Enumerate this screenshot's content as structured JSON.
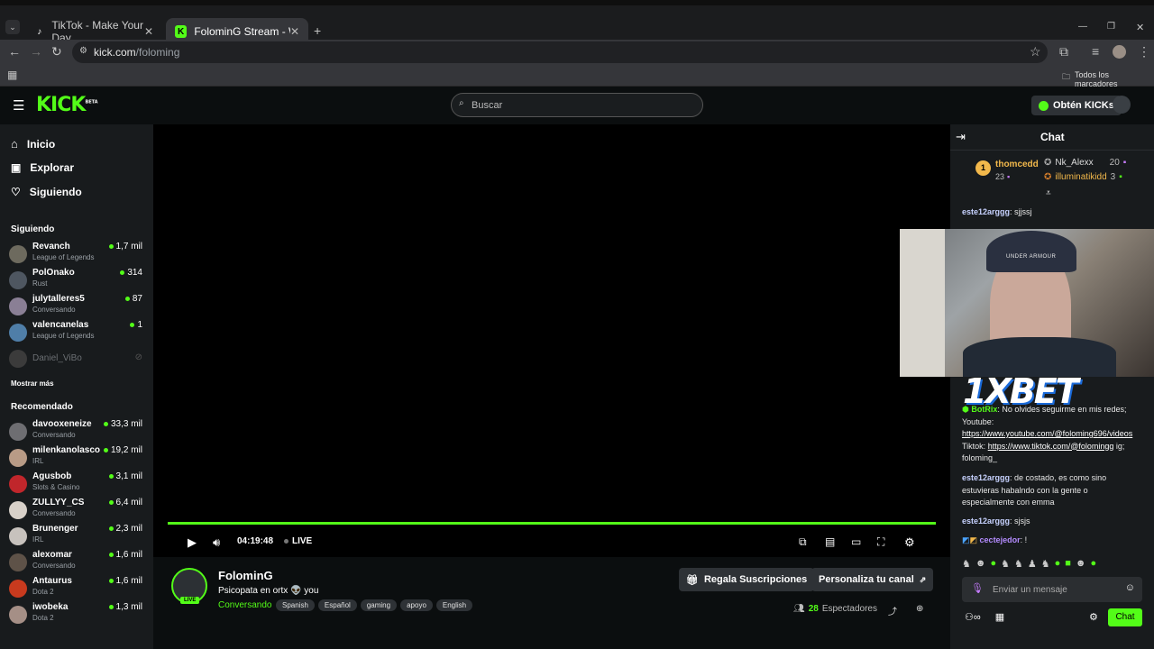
{
  "browser": {
    "tabs": [
      {
        "label": "TikTok - Make Your Day"
      },
      {
        "label": "FolominG Stream - Watch Live o"
      }
    ],
    "url_domain": "kick.com",
    "url_path": "/foloming",
    "bookmarks_label": "Todos los marcadores"
  },
  "header": {
    "logo": "KICK",
    "logo_badge": "BETA",
    "search_placeholder": "Buscar",
    "kicks_button": "Obtén KICKs",
    "accent": "#53fc18"
  },
  "sidebar": {
    "nav": [
      {
        "label": "Inicio",
        "icon": "home-icon"
      },
      {
        "label": "Explorar",
        "icon": "compass-icon"
      },
      {
        "label": "Siguiendo",
        "icon": "heart-icon"
      }
    ],
    "following_title": "Siguiendo",
    "following": [
      {
        "name": "Revanch",
        "category": "League of Legends",
        "viewers": "1,7 mil"
      },
      {
        "name": "PolOnako",
        "category": "Rust",
        "viewers": "314"
      },
      {
        "name": "julytalleres5",
        "category": "Conversando",
        "viewers": "87"
      },
      {
        "name": "valencanelas",
        "category": "League of Legends",
        "viewers": "1"
      }
    ],
    "offline": {
      "name": "Daniel_ViBo"
    },
    "show_more": "Mostrar más",
    "recommended_title": "Recomendado",
    "recommended": [
      {
        "name": "davooxeneize",
        "category": "Conversando",
        "viewers": "33,3 mil"
      },
      {
        "name": "milenkanolasco",
        "category": "IRL",
        "viewers": "19,2 mil"
      },
      {
        "name": "Agusbob",
        "category": "Slots & Casino",
        "viewers": "3,1 mil"
      },
      {
        "name": "ZULLYY_CS",
        "category": "Conversando",
        "viewers": "6,4 mil"
      },
      {
        "name": "Brunenger",
        "category": "IRL",
        "viewers": "2,3 mil"
      },
      {
        "name": "alexomar",
        "category": "Conversando",
        "viewers": "1,6 mil"
      },
      {
        "name": "Antaurus",
        "category": "Dota 2",
        "viewers": "1,6 mil"
      },
      {
        "name": "iwobeka",
        "category": "Dota 2",
        "viewers": "1,3 mil"
      }
    ]
  },
  "player": {
    "time": "04:19:48",
    "live_label": "LIVE",
    "progress": 1.0
  },
  "stream": {
    "streamer": "FolominG",
    "live_badge": "LIVE",
    "title": "Psicopata en ortx 👽 you",
    "category": "Conversando",
    "tags": [
      "Spanish",
      "Español",
      "gaming",
      "apoyo",
      "English"
    ],
    "gift_button": "Regala Suscripciones",
    "customize_button": "Personaliza tu canal",
    "viewers_count": "28",
    "viewers_label": "Espectadores"
  },
  "chat": {
    "title": "Chat",
    "top_gifters": [
      {
        "name": "thomcedd",
        "count": "23",
        "rank": "1"
      },
      {
        "name": "Nk_Alexx",
        "count": "20"
      },
      {
        "name": "illuminatikidd",
        "count": "3"
      }
    ],
    "messages": [
      {
        "user": "este12arggg",
        "text": "sjjssj"
      },
      {
        "user": "BotRix",
        "text": "No olvides seguirme en mis redes; Youtube:"
      },
      {
        "link1": "https://www.youtube.com/@foloming696/videos",
        "mid": "Tiktok:",
        "link2": "https://www.tiktok.com/@folomingg",
        "tail": "ig; foloming_"
      },
      {
        "user": "este12arggg",
        "text": "de costado, es como sino estuvieras habalndo con la gente o especialmente con emma"
      },
      {
        "user": "este12arggg",
        "text": "sjsjs"
      },
      {
        "user": "cectejedor",
        "text": "!"
      }
    ],
    "input_placeholder": "Enviar un mensaje",
    "send_button": "Chat"
  },
  "overlay": {
    "cap_text": "UNDER ARMOUR",
    "brand": "1XBET"
  }
}
